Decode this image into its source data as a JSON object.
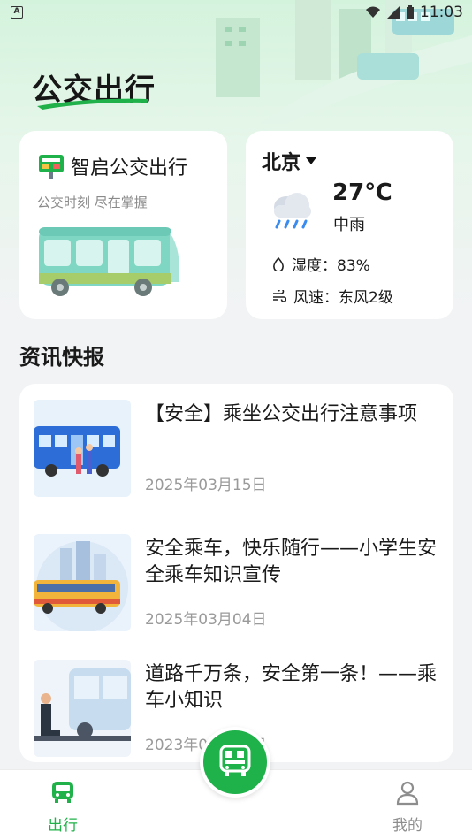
{
  "status_bar": {
    "time": "11:03",
    "app_badge": "A"
  },
  "page": {
    "title": "公交出行"
  },
  "bus_card": {
    "title": "智启公交出行",
    "subtitle": "公交时刻 尽在掌握"
  },
  "weather": {
    "city": "北京",
    "temperature": "27℃",
    "condition": "中雨",
    "humidity": "湿度：83%",
    "wind": "风速：东风2级"
  },
  "news": {
    "section_title": "资讯快报",
    "items": [
      {
        "title": "【安全】乘坐公交出行注意事项",
        "date": "2025年03月15日"
      },
      {
        "title": "安全乘车，快乐随行——小学生安全乘车知识宣传",
        "date": "2025年03月04日"
      },
      {
        "title": "道路千万条，安全第一条！——乘车小知识",
        "date": "2023年09月14日"
      }
    ]
  },
  "tabbar": {
    "left_label": "出行",
    "right_label": "我的"
  },
  "colors": {
    "accent": "#21b14a",
    "bus_body": "#7fd6c3",
    "bg": "#f2f3f5"
  }
}
